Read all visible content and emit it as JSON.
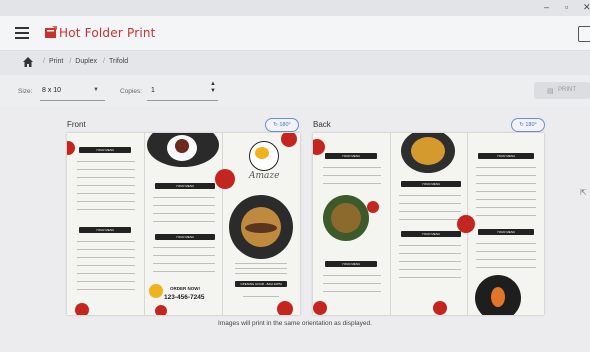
{
  "window": {
    "minimize": "–",
    "maximize": "▫",
    "close": "✕"
  },
  "app": {
    "name": "Hot Folder Print"
  },
  "breadcrumb": [
    "Print",
    "Duplex",
    "Trifold"
  ],
  "options": {
    "size_label": "Size:",
    "size_value": "8 x 10",
    "copies_label": "Copies:",
    "copies_value": "1",
    "print_label": "PRINT"
  },
  "front": {
    "title": "Front",
    "rotate_label": "180°",
    "menu_heading": "YOUR MENU",
    "order_now": "ORDER NOW!",
    "phone": "123-456-7245",
    "opening": "OPENING HOUR - 8AM-10PM",
    "script_title": "Amaze"
  },
  "back": {
    "title": "Back",
    "rotate_label": "180°",
    "menu_heading": "YOUR MENU"
  },
  "footer_note": "Images will print in the same orientation as displayed."
}
